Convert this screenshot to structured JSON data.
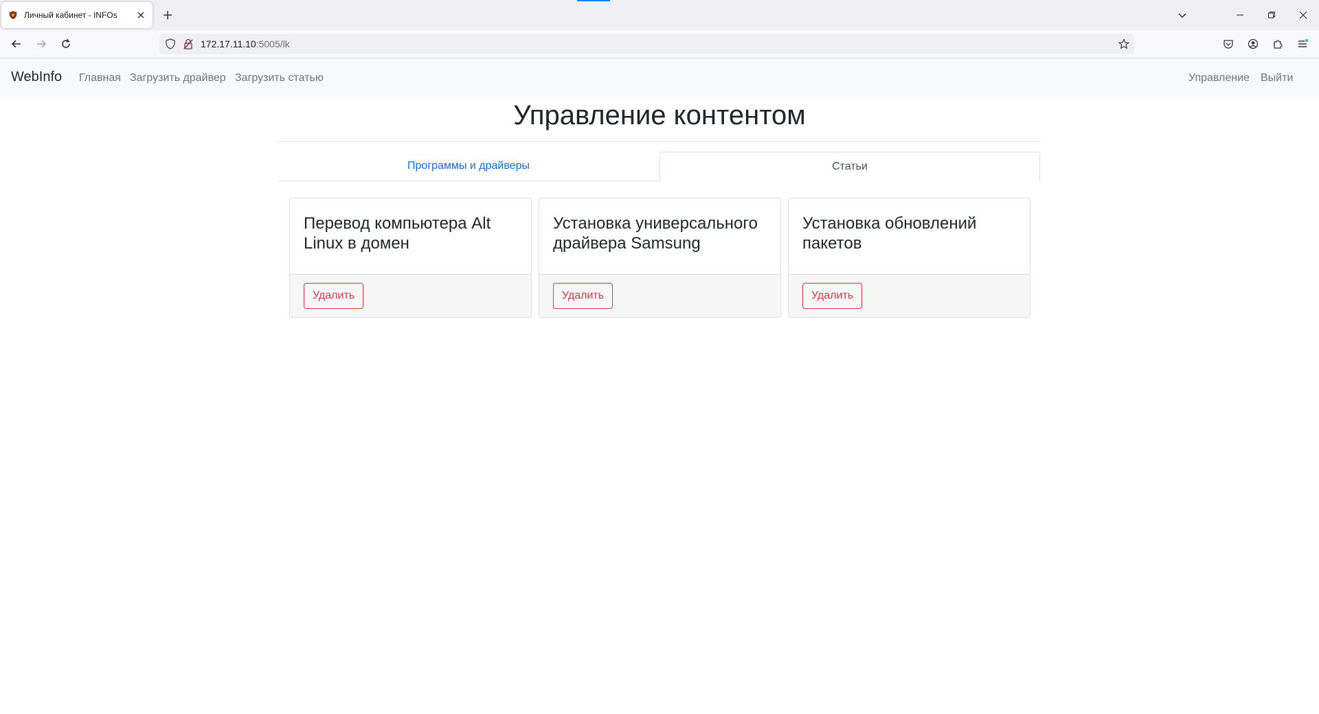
{
  "browser": {
    "tab_title": "Личный кабинет - INFOs",
    "url_host": "172.17.11.10",
    "url_path": ":5005/lk"
  },
  "site": {
    "brand": "WebInfo",
    "nav": {
      "home": "Главная",
      "upload_driver": "Загрузить драйвер",
      "upload_article": "Загрузить статью",
      "manage": "Управление",
      "logout": "Выйти"
    }
  },
  "main": {
    "title": "Управление контентом",
    "tabs": [
      {
        "label": "Программы и драйверы",
        "active": false
      },
      {
        "label": "Статьи",
        "active": true
      }
    ],
    "cards": [
      {
        "title": "Перевод компьютера Alt Linux в домен",
        "button": "Удалить"
      },
      {
        "title": "Установка универсального драйвера Samsung",
        "button": "Удалить"
      },
      {
        "title": "Установка обновлений пакетов",
        "button": "Удалить"
      }
    ]
  },
  "colors": {
    "link": "#0d6efd",
    "danger": "#dc3545",
    "navbar_bg": "#f8f9fa"
  }
}
